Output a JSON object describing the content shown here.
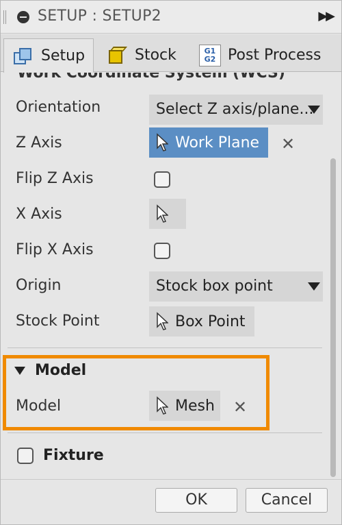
{
  "window": {
    "title": "SETUP : SETUP2",
    "icon": "minus-circle-icon",
    "expand_icon": "▶▶"
  },
  "tabs": [
    {
      "label": "Setup",
      "icon": "setup-cubes-icon",
      "active": true
    },
    {
      "label": "Stock",
      "icon": "stock-box-icon",
      "active": false
    },
    {
      "label": "Post Process",
      "icon": "g1g2-icon",
      "active": false,
      "icon_text": [
        "G1",
        "G2"
      ]
    }
  ],
  "wcs": {
    "header": "Work Coordinate System (WCS)",
    "orientation": {
      "label": "Orientation",
      "value": "Select Z axis/plane..."
    },
    "z_axis": {
      "label": "Z Axis",
      "value": "Work Plane",
      "selected": true
    },
    "flip_z": {
      "label": "Flip Z Axis",
      "checked": false
    },
    "x_axis": {
      "label": "X Axis",
      "value": ""
    },
    "flip_x": {
      "label": "Flip X Axis",
      "checked": false
    },
    "origin": {
      "label": "Origin",
      "value": "Stock box point"
    },
    "stock_point": {
      "label": "Stock Point",
      "value": "Box Point"
    }
  },
  "model_section": {
    "title": "Model",
    "model": {
      "label": "Model",
      "value": "Mesh"
    },
    "highlight_color": "#f08a00"
  },
  "fixture": {
    "label": "Fixture",
    "checked": false
  },
  "footer": {
    "ok_label": "OK",
    "cancel_label": "Cancel"
  },
  "colors": {
    "selected_blue": "#5b8ec4",
    "panel_bg": "#e6e6e6"
  }
}
